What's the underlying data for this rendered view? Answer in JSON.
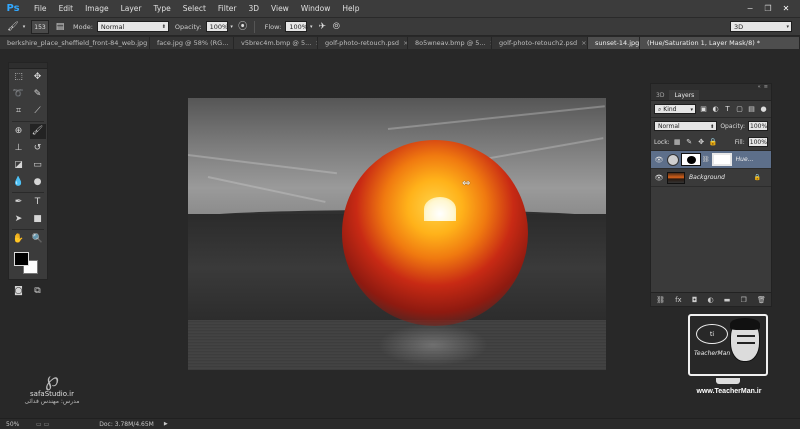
{
  "app": {
    "logo_text": "Ps"
  },
  "menu": [
    "File",
    "Edit",
    "Image",
    "Layer",
    "Type",
    "Select",
    "Filter",
    "3D",
    "View",
    "Window",
    "Help"
  ],
  "window_controls": {
    "minimize": "−",
    "restore": "❐",
    "close": "✕"
  },
  "options_bar": {
    "brush_size": "153",
    "mode_label": "Mode:",
    "mode_value": "Normal",
    "opacity_label": "Opacity:",
    "opacity_value": "100%",
    "flow_label": "Flow:",
    "flow_value": "100%",
    "workspace": "3D"
  },
  "tabs": [
    {
      "label": "berkshire_place_sheffield_front-84_web.jpg"
    },
    {
      "label": "face.jpg @ 58% (RG..."
    },
    {
      "label": "v5brec4m.bmp @ 5..."
    },
    {
      "label": "golf-photo-retouch.psd"
    },
    {
      "label": "8o5wneav.bmp @ 5..."
    },
    {
      "label": "golf-photo-retouch2.psd"
    },
    {
      "label": "sunset-14.jpg"
    },
    {
      "label": "(Hue/Saturation 1, Layer Mask/8) *"
    }
  ],
  "layers_panel": {
    "tab_3d": "3D",
    "tab_layers": "Layers",
    "filter_kind": "Kind",
    "blend_mode": "Normal",
    "opacity_label": "Opacity:",
    "opacity_value": "100%",
    "lock_label": "Lock:",
    "fill_label": "Fill:",
    "fill_value": "100%",
    "layers": [
      {
        "name": "Hue...",
        "selected": true
      },
      {
        "name": "Background",
        "selected": false
      }
    ]
  },
  "watermarks": {
    "safa_site": "safaStudio.ir",
    "safa_sub": "مدرس: مهندس فدائی",
    "teacher_bubble": "ti",
    "teacher_label": "TeacherMan",
    "teacher_url": "www.TeacherMan.ir"
  },
  "status": {
    "zoom": "50%",
    "doc": "Doc: 3.78M/4.65M"
  }
}
